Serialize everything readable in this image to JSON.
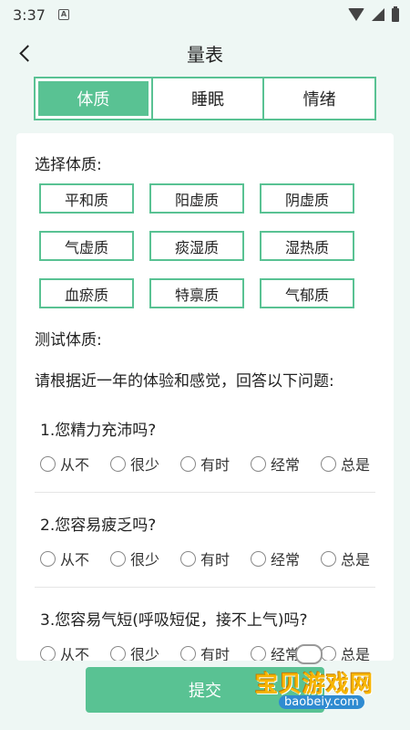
{
  "status": {
    "time": "3:37",
    "indicator": "A"
  },
  "header": {
    "title": "量表"
  },
  "tabs": [
    {
      "label": "体质",
      "active": true
    },
    {
      "label": "睡眠",
      "active": false
    },
    {
      "label": "情绪",
      "active": false
    }
  ],
  "constitution": {
    "label": "选择体质:",
    "options": [
      "平和质",
      "阳虚质",
      "阴虚质",
      "气虚质",
      "痰湿质",
      "湿热质",
      "血瘀质",
      "特禀质",
      "气郁质"
    ]
  },
  "test": {
    "label": "测试体质:",
    "instruction": "请根据近一年的体验和感觉，回答以下问题:",
    "answer_options": [
      "从不",
      "很少",
      "有时",
      "经常",
      "总是"
    ],
    "questions": [
      {
        "text": "1.您精力充沛吗?"
      },
      {
        "text": "2.您容易疲乏吗?"
      },
      {
        "text": "3.您容易气短(呼吸短促，接不上气)吗?"
      }
    ]
  },
  "submit_label": "提交",
  "watermark": {
    "title": "宝贝游戏网",
    "site": "baobeiy.com"
  },
  "colors": {
    "accent": "#59c293",
    "background": "#eef7f4"
  }
}
